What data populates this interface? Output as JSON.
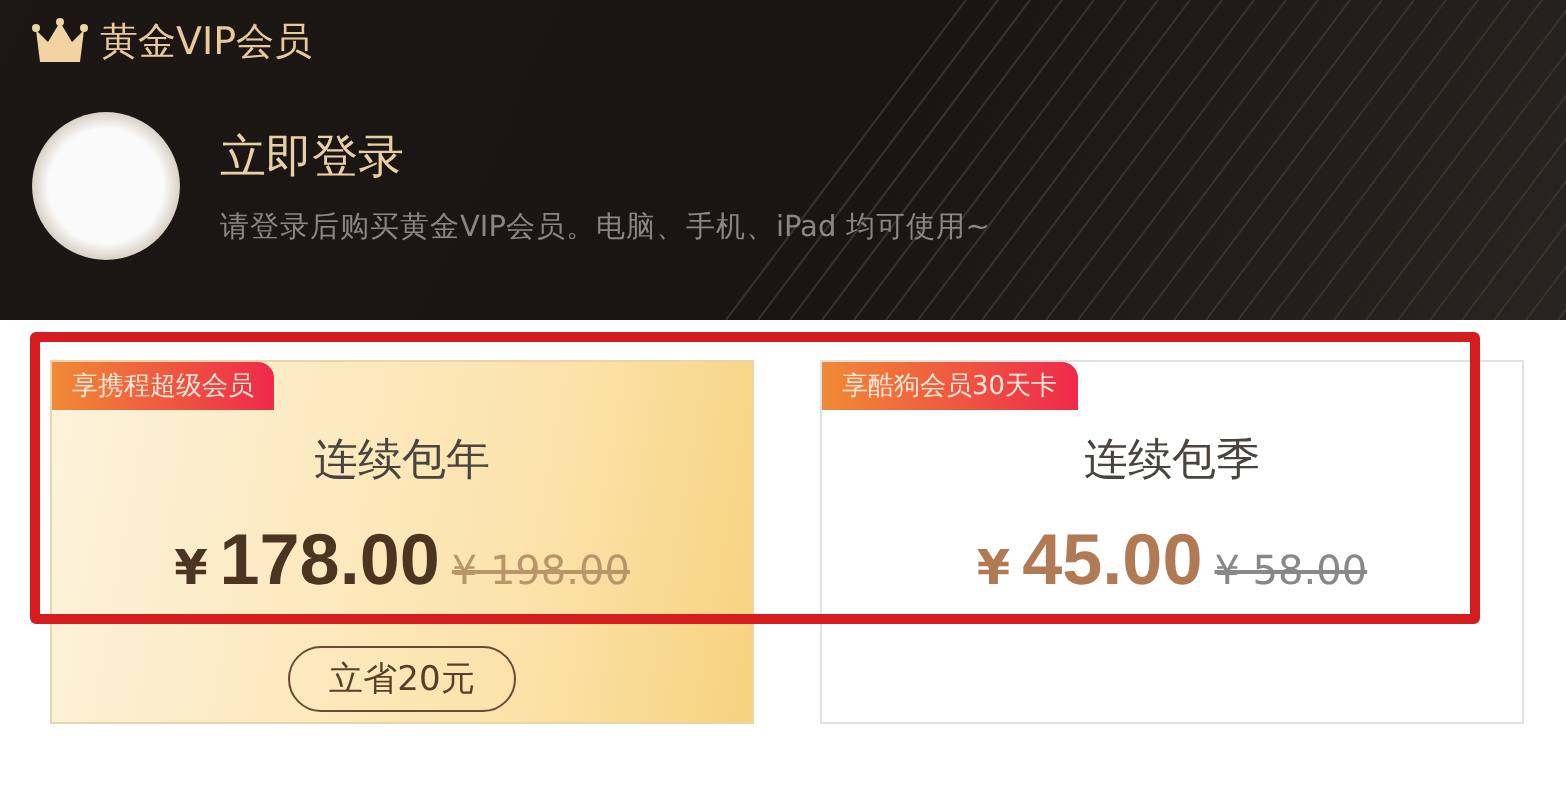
{
  "header": {
    "title": "黄金VIP会员",
    "login_title": "立即登录",
    "login_hint": "请登录后购买黄金VIP会员。电脑、手机、iPad 均可使用~"
  },
  "plans": [
    {
      "badge": "享携程超级会员",
      "name": "连续包年",
      "currency": "¥",
      "price": "178.00",
      "original_price": "¥ 198.00",
      "saving": "立省20元",
      "selected": true
    },
    {
      "badge": "享酷狗会员30天卡",
      "name": "连续包季",
      "currency": "¥",
      "price": "45.00",
      "original_price": "¥ 58.00",
      "selected": false
    }
  ],
  "highlight": {
    "kind": "annotation-frame"
  }
}
